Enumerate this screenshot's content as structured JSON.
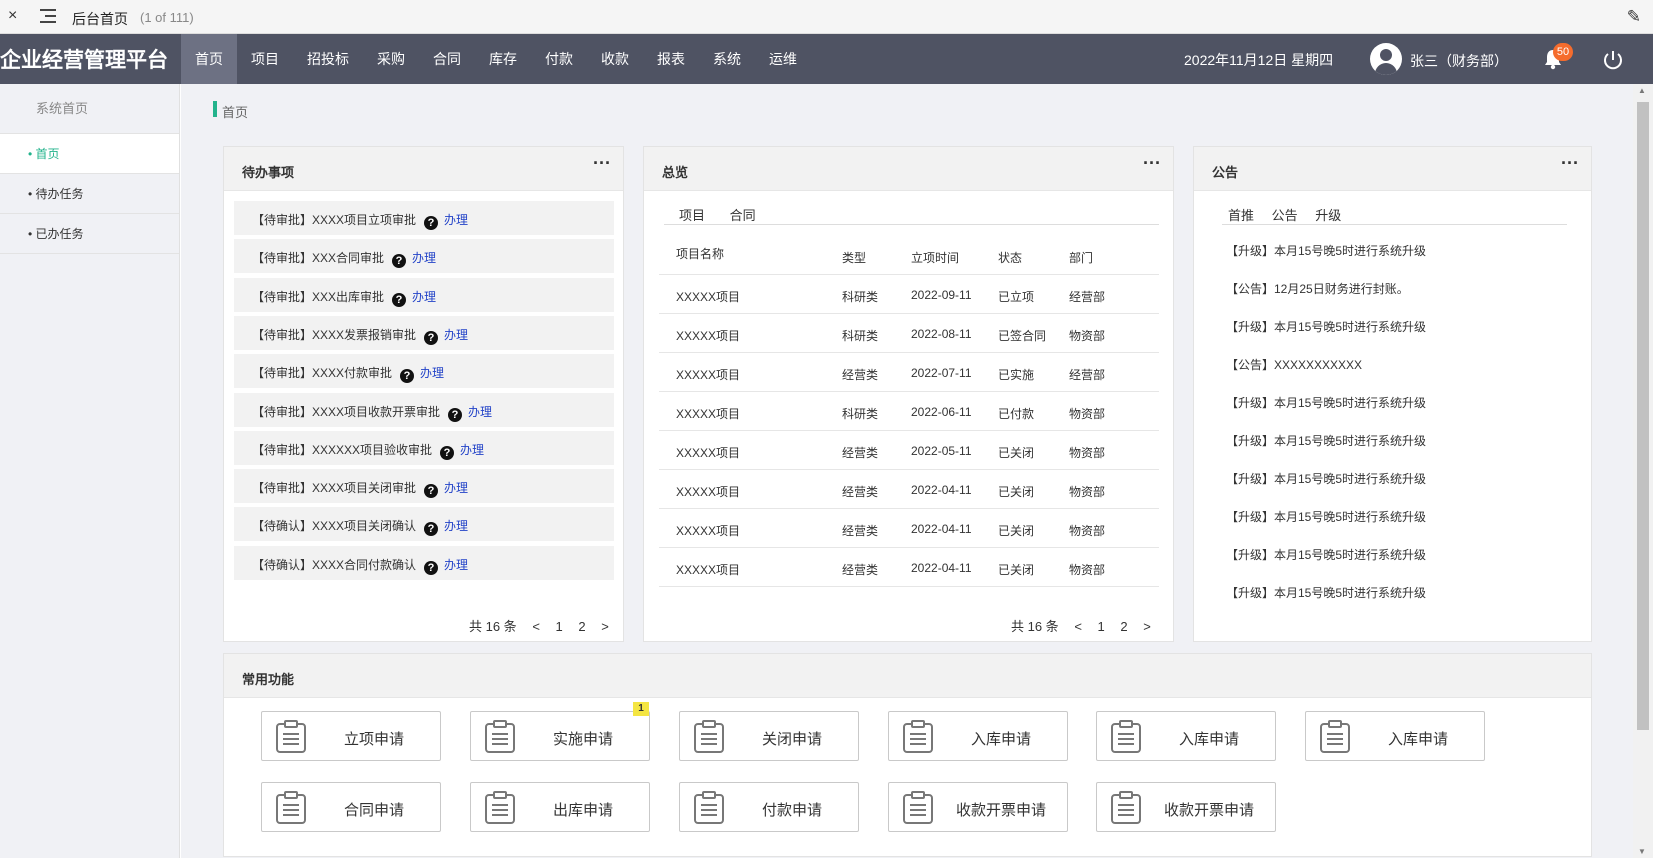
{
  "viewer": {
    "title": "后台首页",
    "count": "(1 of 111)",
    "close_icon": "×",
    "edit_icon": "✎"
  },
  "header": {
    "brand": "企业经营管理平台",
    "nav": [
      "首页",
      "项目",
      "招投标",
      "采购",
      "合同",
      "库存",
      "付款",
      "收款",
      "报表",
      "系统",
      "运维"
    ],
    "date": "2022年11月12日  星期四",
    "user": "张三（财务部）",
    "notifications": "50",
    "colors": {
      "bar": "#4f5363",
      "active": "#6d7183",
      "accent": "#23b38c",
      "badge": "#f56c2d"
    }
  },
  "sidebar": {
    "section": "系统首页",
    "items": [
      "• 首页",
      "• 待办任务",
      "• 已办任务"
    ]
  },
  "breadcrumb": "首页",
  "todo": {
    "title": "待办事项",
    "more": "···",
    "items": [
      "【待审批】XXXX项目立项审批",
      "【待审批】XXX合同审批",
      "【待审批】XXX出库审批",
      "【待审批】XXXX发票报销审批",
      "【待审批】XXXX付款审批",
      "【待审批】XXXX项目收款开票审批",
      "【待审批】XXXXXX项目验收审批",
      "【待审批】XXXX项目关闭审批",
      "【待确认】XXXX项目关闭确认",
      "【待确认】XXXX合同付款确认"
    ],
    "action": "办理",
    "help": "?",
    "pager": {
      "total": "共 16 条",
      "prev": "<",
      "p1": "1",
      "p2": "2",
      "next": ">"
    }
  },
  "overview": {
    "title": "总览",
    "more": "···",
    "tabs": [
      "项目",
      "合同"
    ],
    "columns": [
      "项目名称",
      "类型",
      "立项时间",
      "状态",
      "部门"
    ],
    "rows": [
      [
        "XXXXX项目",
        "科研类",
        "2022-09-11",
        "已立项",
        "经营部"
      ],
      [
        "XXXXX项目",
        "科研类",
        "2022-08-11",
        "已签合同",
        "物资部"
      ],
      [
        "XXXXX项目",
        "经营类",
        "2022-07-11",
        "已实施",
        "经营部"
      ],
      [
        "XXXXX项目",
        "科研类",
        "2022-06-11",
        "已付款",
        "物资部"
      ],
      [
        "XXXXX项目",
        "经营类",
        "2022-05-11",
        "已关闭",
        "物资部"
      ],
      [
        "XXXXX项目",
        "经营类",
        "2022-04-11",
        "已关闭",
        "物资部"
      ],
      [
        "XXXXX项目",
        "经营类",
        "2022-04-11",
        "已关闭",
        "物资部"
      ],
      [
        "XXXXX项目",
        "经营类",
        "2022-04-11",
        "已关闭",
        "物资部"
      ]
    ],
    "pager": {
      "total": "共 16 条",
      "prev": "<",
      "p1": "1",
      "p2": "2",
      "next": ">"
    }
  },
  "notice": {
    "title": "公告",
    "more": "···",
    "tabs": [
      "首推",
      "公告",
      "升级"
    ],
    "items": [
      "【升级】本月15号晚5时进行系统升级",
      "【公告】12月25日财务进行封账。",
      "【升级】本月15号晚5时进行系统升级",
      "【公告】XXXXXXXXXXX",
      "【升级】本月15号晚5时进行系统升级",
      "【升级】本月15号晚5时进行系统升级",
      "【升级】本月15号晚5时进行系统升级",
      "【升级】本月15号晚5时进行系统升级",
      "【升级】本月15号晚5时进行系统升级",
      "【升级】本月15号晚5时进行系统升级"
    ]
  },
  "functions": {
    "title": "常用功能",
    "items": [
      "立项申请",
      "实施申请",
      "关闭申请",
      "入库申请",
      "入库申请",
      "入库申请",
      "合同申请",
      "出库申请",
      "付款申请",
      "收款开票申请",
      "收款开票申请"
    ],
    "badge": "1"
  }
}
